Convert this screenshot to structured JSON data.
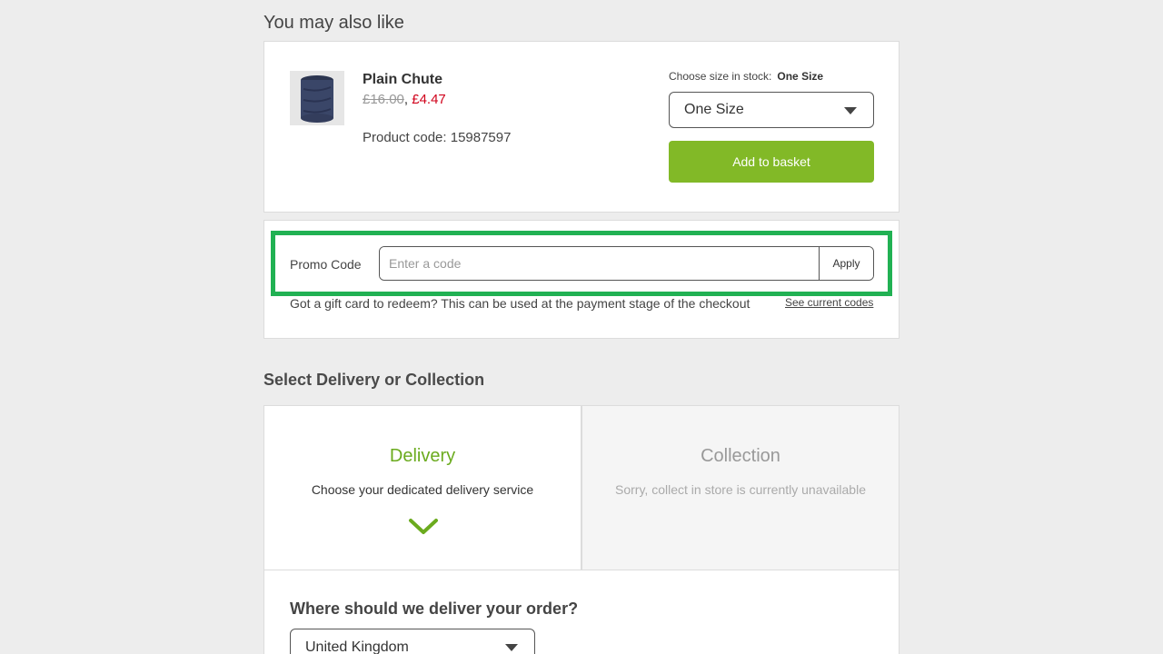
{
  "recommendations": {
    "heading": "You may also like",
    "product": {
      "name": "Plain Chute",
      "old_price": "£16.00",
      "separator": ",",
      "new_price": "£4.47",
      "code_label": "Product code: 15987597",
      "image_icon": "neck-gaiter-image",
      "size_label": "Choose size in stock:",
      "size_in_stock": "One Size",
      "size_selected": "One Size",
      "add_button": "Add to basket"
    }
  },
  "promo": {
    "label": "Promo Code",
    "placeholder": "Enter a code",
    "value": "",
    "apply_button": "Apply",
    "gift_card_text": "Got a gift card to redeem? This can be used at the payment stage of the checkout",
    "codes_link": "See current codes"
  },
  "delivery": {
    "heading": "Select Delivery or Collection",
    "options": [
      {
        "title": "Delivery",
        "description": "Choose your dedicated delivery service",
        "selected": true
      },
      {
        "title": "Collection",
        "description": "Sorry, collect in store is currently unavailable",
        "selected": false
      }
    ],
    "deliver_heading": "Where should we deliver your order?",
    "country": "United Kingdom"
  },
  "colors": {
    "accent_green": "#82b927",
    "highlight_green": "#21b153",
    "sale_red": "#d0021b",
    "background": "#ededed"
  }
}
